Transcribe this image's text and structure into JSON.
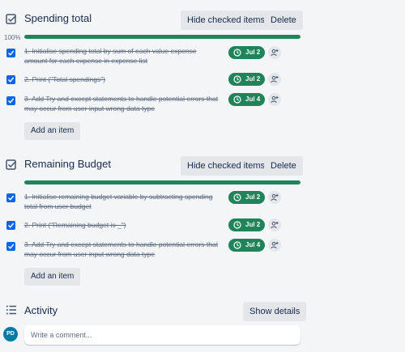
{
  "colors": {
    "accent": "#0c66e4",
    "success": "#1f845a",
    "button_bg": "#e4e6ea"
  },
  "checklists": [
    {
      "title": "Spending total",
      "hide_label": "Hide checked items",
      "delete_label": "Delete",
      "progress_label": "100%",
      "progress": 1.0,
      "items": [
        {
          "text": "1. Initialise spending total by sum of each value expense amount for each expense in expense list",
          "due": "Jul 2",
          "checked": true
        },
        {
          "text": "2. Print (\"Total spendings\")",
          "due": "Jul 2",
          "checked": true
        },
        {
          "text": "3. Add Try and except statements to handle potential errors that may occur from user input wrong data type",
          "due": "Jul 4",
          "checked": true
        }
      ],
      "add_label": "Add an item"
    },
    {
      "title": "Remaining Budget",
      "hide_label": "Hide checked items",
      "delete_label": "Delete",
      "progress_label": "",
      "progress": 1.0,
      "items": [
        {
          "text": "1. Initialise remaining budget variable by subtracting spending total from user budget",
          "due": "Jul 2",
          "checked": true
        },
        {
          "text": "2. Print (\"Remaining budget is _\")",
          "due": "Jul 2",
          "checked": true
        },
        {
          "text": "3. Add Try and except statements to handle potential errors that may occur from user input wrong data type",
          "due": "Jul 4",
          "checked": true
        }
      ],
      "add_label": "Add an item"
    }
  ],
  "activity": {
    "title": "Activity",
    "show_details_label": "Show details",
    "avatar_initials": "PD",
    "comment_placeholder": "Write a comment..."
  },
  "icons": {
    "checklist": "checklist-icon",
    "checkbox": "check-icon",
    "clock": "clock-icon",
    "assign": "add-member-icon",
    "activity": "activity-list-icon"
  }
}
